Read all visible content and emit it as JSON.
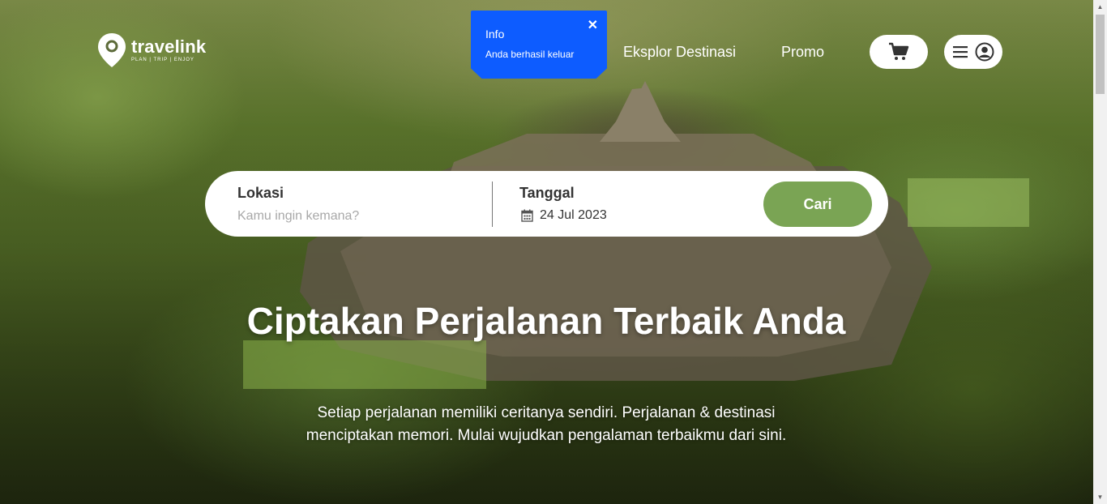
{
  "brand": {
    "name": "travelink",
    "tagline": "PLAN | TRIP | ENJOY"
  },
  "nav": {
    "eksplor": "Eksplor Destinasi",
    "promo": "Promo"
  },
  "toast": {
    "title": "Info",
    "message": "Anda berhasil keluar",
    "close": "✕"
  },
  "search": {
    "lokasi_label": "Lokasi",
    "lokasi_placeholder": "Kamu ingin kemana?",
    "tanggal_label": "Tanggal",
    "tanggal_value": "24 Jul 2023",
    "button": "Cari"
  },
  "hero": {
    "headline": "Ciptakan Perjalanan Terbaik Anda",
    "subtext": "Setiap perjalanan memiliki ceritanya sendiri. Perjalanan & destinasi menciptakan memori. Mulai wujudkan pengalaman terbaikmu dari sini."
  },
  "colors": {
    "accent": "#7aa454",
    "toast": "#0d5cff"
  },
  "icons": [
    "location-pin-icon",
    "cart-icon",
    "hamburger-icon",
    "user-icon",
    "calendar-icon",
    "close-icon"
  ]
}
